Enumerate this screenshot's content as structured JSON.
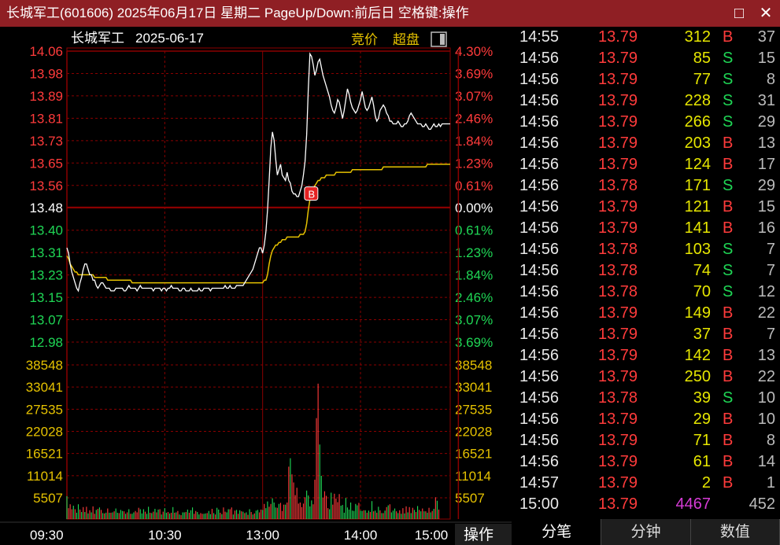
{
  "window": {
    "title": "长城军工(601606) 2025年06月17日 星期二 PageUp/Down:前后日 空格键:操作",
    "maximize_icon": "□",
    "close_icon": "✕"
  },
  "chart_header": {
    "stock_name": "长城军工",
    "date": "2025-06-17",
    "auction_label": "竞价",
    "super_label": "超盘"
  },
  "colors": {
    "up": "#ff3b3b",
    "down": "#1fd655",
    "avg": "#e6c200",
    "price": "#ffffff",
    "grid": "#8b0000",
    "title_bg": "#8f1f24"
  },
  "chart_data": [
    {
      "type": "line",
      "title": "",
      "prev_close": 13.48,
      "y_ticks_left": [
        "14.06",
        "13.98",
        "13.89",
        "13.81",
        "13.73",
        "13.65",
        "13.56",
        "13.48",
        "13.40",
        "13.31",
        "13.23",
        "13.15",
        "13.07",
        "12.98"
      ],
      "y_ticks_right": [
        "4.30%",
        "3.69%",
        "3.07%",
        "2.46%",
        "1.84%",
        "1.23%",
        "0.61%",
        "0.00%",
        "0.61%",
        "1.23%",
        "1.84%",
        "2.46%",
        "3.07%",
        "3.69%"
      ],
      "ylim": [
        12.98,
        14.06
      ],
      "x_ticks": [
        "09:30",
        "10:30",
        "13:00",
        "14:00",
        "15:00"
      ],
      "marker": {
        "label": "B",
        "time_index": 150,
        "price": 13.53
      },
      "series": [
        {
          "name": "",
          "values": [
            13.33,
            13.31,
            13.27,
            13.24,
            13.22,
            13.2,
            13.18,
            13.17,
            13.2,
            13.22,
            13.25,
            13.27,
            13.27,
            13.25,
            13.23,
            13.23,
            13.21,
            13.21,
            13.19,
            13.18,
            13.19,
            13.2,
            13.2,
            13.19,
            13.18,
            13.18,
            13.18,
            13.17,
            13.17,
            13.17,
            13.18,
            13.18,
            13.18,
            13.18,
            13.18,
            13.17,
            13.17,
            13.18,
            13.19,
            13.18,
            13.18,
            13.18,
            13.18,
            13.17,
            13.18,
            13.19,
            13.18,
            13.18,
            13.18,
            13.18,
            13.18,
            13.18,
            13.18,
            13.17,
            13.18,
            13.18,
            13.18,
            13.18,
            13.17,
            13.18,
            13.18,
            13.17,
            13.18,
            13.18,
            13.19,
            13.18,
            13.18,
            13.18,
            13.18,
            13.17,
            13.17,
            13.18,
            13.18,
            13.17,
            13.17,
            13.17,
            13.18,
            13.17,
            13.17,
            13.17,
            13.17,
            13.18,
            13.17,
            13.17,
            13.18,
            13.18,
            13.18,
            13.18,
            13.17,
            13.18,
            13.18,
            13.18,
            13.18,
            13.18,
            13.18,
            13.18,
            13.18,
            13.19,
            13.18,
            13.18,
            13.19,
            13.18,
            13.18,
            13.18,
            13.19,
            13.19,
            13.19,
            13.19,
            13.19,
            13.2,
            13.21,
            13.22,
            13.23,
            13.24,
            13.25,
            13.27,
            13.29,
            13.31,
            13.33,
            13.33,
            13.31,
            13.34,
            13.39,
            13.47,
            13.58,
            13.7,
            13.76,
            13.73,
            13.66,
            13.6,
            13.62,
            13.64,
            13.6,
            13.59,
            13.58,
            13.61,
            13.58,
            13.57,
            13.54,
            13.53,
            13.53,
            13.52,
            13.52,
            13.54,
            13.56,
            13.6,
            13.65,
            13.75,
            13.92,
            14.05,
            14.04,
            14.01,
            13.97,
            13.99,
            14.02,
            14.03,
            14.0,
            13.97,
            13.95,
            13.93,
            13.91,
            13.89,
            13.86,
            13.84,
            13.83,
            13.85,
            13.88,
            13.87,
            13.84,
            13.81,
            13.84,
            13.88,
            13.92,
            13.9,
            13.87,
            13.85,
            13.84,
            13.83,
            13.84,
            13.86,
            13.88,
            13.91,
            13.88,
            13.85,
            13.84,
            13.85,
            13.87,
            13.89,
            13.86,
            13.82,
            13.8,
            13.81,
            13.84,
            13.85,
            13.86,
            13.85,
            13.83,
            13.82,
            13.8,
            13.8,
            13.79,
            13.79,
            13.79,
            13.8,
            13.79,
            13.78,
            13.78,
            13.79,
            13.79,
            13.8,
            13.82,
            13.83,
            13.82,
            13.81,
            13.8,
            13.79,
            13.79,
            13.79,
            13.78,
            13.78,
            13.79,
            13.78,
            13.77,
            13.77,
            13.78,
            13.79,
            13.78,
            13.78,
            13.79,
            13.78,
            13.79,
            13.79,
            13.79,
            13.79,
            13.79,
            13.79
          ]
        },
        {
          "name": "",
          "values": [
            13.3,
            13.29,
            13.27,
            13.26,
            13.25,
            13.24,
            13.24,
            13.23,
            13.23,
            13.23,
            13.23,
            13.23,
            13.23,
            13.23,
            13.23,
            13.23,
            13.23,
            13.22,
            13.22,
            13.22,
            13.22,
            13.22,
            13.22,
            13.22,
            13.22,
            13.21,
            13.21,
            13.21,
            13.21,
            13.21,
            13.21,
            13.21,
            13.21,
            13.21,
            13.21,
            13.21,
            13.21,
            13.21,
            13.21,
            13.21,
            13.2,
            13.2,
            13.2,
            13.2,
            13.2,
            13.2,
            13.2,
            13.2,
            13.2,
            13.2,
            13.2,
            13.2,
            13.2,
            13.2,
            13.2,
            13.2,
            13.2,
            13.2,
            13.2,
            13.2,
            13.2,
            13.2,
            13.2,
            13.2,
            13.2,
            13.2,
            13.2,
            13.2,
            13.2,
            13.2,
            13.2,
            13.2,
            13.2,
            13.2,
            13.2,
            13.2,
            13.2,
            13.2,
            13.2,
            13.2,
            13.2,
            13.2,
            13.2,
            13.2,
            13.2,
            13.2,
            13.2,
            13.2,
            13.2,
            13.2,
            13.2,
            13.2,
            13.2,
            13.2,
            13.2,
            13.2,
            13.2,
            13.2,
            13.2,
            13.2,
            13.2,
            13.2,
            13.2,
            13.2,
            13.2,
            13.2,
            13.2,
            13.2,
            13.2,
            13.2,
            13.2,
            13.2,
            13.2,
            13.2,
            13.2,
            13.2,
            13.2,
            13.2,
            13.2,
            13.2,
            13.2,
            13.21,
            13.21,
            13.23,
            13.27,
            13.3,
            13.32,
            13.33,
            13.34,
            13.34,
            13.35,
            13.35,
            13.36,
            13.36,
            13.36,
            13.37,
            13.37,
            13.37,
            13.37,
            13.37,
            13.37,
            13.37,
            13.37,
            13.38,
            13.38,
            13.38,
            13.39,
            13.42,
            13.47,
            13.51,
            13.53,
            13.55,
            13.56,
            13.57,
            13.58,
            13.58,
            13.59,
            13.59,
            13.59,
            13.6,
            13.6,
            13.6,
            13.6,
            13.6,
            13.6,
            13.61,
            13.61,
            13.61,
            13.61,
            13.61,
            13.61,
            13.61,
            13.61,
            13.61,
            13.61,
            13.62,
            13.62,
            13.62,
            13.62,
            13.62,
            13.62,
            13.62,
            13.62,
            13.62,
            13.62,
            13.62,
            13.62,
            13.62,
            13.62,
            13.62,
            13.62,
            13.62,
            13.62,
            13.62,
            13.63,
            13.63,
            13.63,
            13.63,
            13.63,
            13.63,
            13.63,
            13.63,
            13.63,
            13.63,
            13.63,
            13.63,
            13.63,
            13.63,
            13.63,
            13.63,
            13.63,
            13.63,
            13.63,
            13.63,
            13.63,
            13.63,
            13.63,
            13.63,
            13.63,
            13.63,
            13.63,
            13.64,
            13.64,
            13.64,
            13.64,
            13.64,
            13.64,
            13.64,
            13.64,
            13.64,
            13.64,
            13.64,
            13.64,
            13.64,
            13.64,
            13.64
          ]
        }
      ]
    },
    {
      "type": "bar",
      "title": "",
      "y_ticks": [
        "38548",
        "33041",
        "27535",
        "22028",
        "16521",
        "11014",
        "5507"
      ],
      "ylim": [
        0,
        44055
      ],
      "values": [
        6500,
        3100,
        4200,
        2800,
        3800,
        2800,
        1800,
        4200,
        2700,
        2000,
        3400,
        2000,
        3500,
        1600,
        2500,
        1900,
        3600,
        1500,
        2600,
        2900,
        3300,
        2600,
        1700,
        1600,
        1800,
        3000,
        1800,
        1800,
        1900,
        2200,
        3000,
        1800,
        1700,
        2600,
        2300,
        2200,
        1500,
        1900,
        2800,
        1500,
        1500,
        1900,
        2300,
        1900,
        3200,
        2800,
        1600,
        2800,
        2100,
        1500,
        3500,
        1800,
        1700,
        2100,
        2900,
        1900,
        2700,
        2800,
        1300,
        2100,
        3100,
        1800,
        2000,
        1600,
        1800,
        3400,
        1800,
        1900,
        2300,
        1300,
        1100,
        1900,
        1900,
        2000,
        2700,
        1800,
        2500,
        3300,
        1500,
        2300,
        2000,
        1300,
        1700,
        1500,
        1500,
        1600,
        1700,
        2300,
        1400,
        2900,
        1700,
        1300,
        3200,
        2700,
        1800,
        1400,
        3300,
        2100,
        1900,
        2800,
        2800,
        3300,
        1300,
        2400,
        2600,
        1500,
        2500,
        2200,
        2100,
        1700,
        1900,
        1200,
        2800,
        2000,
        1300,
        1600,
        2400,
        2600,
        1900,
        2700,
        2600,
        4300,
        3100,
        5000,
        3500,
        4300,
        5900,
        4700,
        3300,
        3200,
        4300,
        4600,
        2300,
        4100,
        4100,
        4700,
        14900,
        17300,
        12700,
        10400,
        6800,
        8900,
        4400,
        4700,
        3400,
        4400,
        6200,
        8100,
        6700,
        3600,
        5300,
        4200,
        11200,
        28700,
        38500,
        21200,
        12300,
        6000,
        7900,
        6600,
        3100,
        2800,
        7500,
        4100,
        7200,
        5800,
        4800,
        7100,
        3800,
        4000,
        1800,
        6000,
        3300,
        2700,
        4700,
        2400,
        2300,
        4300,
        3900,
        4600,
        2400,
        2300,
        2500,
        2500,
        1800,
        2400,
        2000,
        5100,
        2200,
        2400,
        1800,
        3500,
        2500,
        1700,
        1700,
        2400,
        3400,
        3900,
        4200,
        1900,
        2400,
        3000,
        2200,
        1700,
        2500,
        1500,
        3100,
        1600,
        3600,
        1900,
        3400,
        1700,
        3200,
        2600,
        2000,
        3700,
        2600,
        2200,
        3000,
        2200,
        2200,
        1800,
        3200,
        1900,
        2300,
        2900,
        6200,
        5200,
        2700
      ],
      "directions": "SBBBSBSSBSBSBSBSBBSBSBSBSBSBSBSSBSSBSBSBSSBBBSSSBSSBSBSBSBSBSSBSBSBSBSBSSBSBSSBBSSBBSSBSSBSBSSBSBBSSBBSBSBSBSBSBSBSBSSBBSBSSBBSSSBSBBBSBBSBBBBBBBBBSSSSBBBBSSBBBBSSBBBBBSSSSSSSSSSSBSSBSBSBSBSBSBSBSBSBSSSBSBSBSBSBSBSBSBSBSBSBSBSBSBSBSSBSBSBBS"
    }
  ],
  "panel_label": "操作",
  "trades": [
    {
      "time": "14:55",
      "price": "13.79",
      "vol": "312",
      "side": "B",
      "count": "37"
    },
    {
      "time": "14:56",
      "price": "13.79",
      "vol": "85",
      "side": "S",
      "count": "15"
    },
    {
      "time": "14:56",
      "price": "13.79",
      "vol": "77",
      "side": "S",
      "count": "8"
    },
    {
      "time": "14:56",
      "price": "13.79",
      "vol": "228",
      "side": "S",
      "count": "31"
    },
    {
      "time": "14:56",
      "price": "13.79",
      "vol": "266",
      "side": "S",
      "count": "29"
    },
    {
      "time": "14:56",
      "price": "13.79",
      "vol": "203",
      "side": "B",
      "count": "13"
    },
    {
      "time": "14:56",
      "price": "13.79",
      "vol": "124",
      "side": "B",
      "count": "17"
    },
    {
      "time": "14:56",
      "price": "13.78",
      "vol": "171",
      "side": "S",
      "count": "29"
    },
    {
      "time": "14:56",
      "price": "13.79",
      "vol": "121",
      "side": "B",
      "count": "15"
    },
    {
      "time": "14:56",
      "price": "13.79",
      "vol": "141",
      "side": "B",
      "count": "16"
    },
    {
      "time": "14:56",
      "price": "13.78",
      "vol": "103",
      "side": "S",
      "count": "7"
    },
    {
      "time": "14:56",
      "price": "13.78",
      "vol": "74",
      "side": "S",
      "count": "7"
    },
    {
      "time": "14:56",
      "price": "13.78",
      "vol": "70",
      "side": "S",
      "count": "12"
    },
    {
      "time": "14:56",
      "price": "13.79",
      "vol": "149",
      "side": "B",
      "count": "22"
    },
    {
      "time": "14:56",
      "price": "13.79",
      "vol": "37",
      "side": "B",
      "count": "7"
    },
    {
      "time": "14:56",
      "price": "13.79",
      "vol": "142",
      "side": "B",
      "count": "13"
    },
    {
      "time": "14:56",
      "price": "13.79",
      "vol": "250",
      "side": "B",
      "count": "22"
    },
    {
      "time": "14:56",
      "price": "13.78",
      "vol": "39",
      "side": "S",
      "count": "10"
    },
    {
      "time": "14:56",
      "price": "13.79",
      "vol": "29",
      "side": "B",
      "count": "10"
    },
    {
      "time": "14:56",
      "price": "13.79",
      "vol": "71",
      "side": "B",
      "count": "8"
    },
    {
      "time": "14:56",
      "price": "13.79",
      "vol": "61",
      "side": "B",
      "count": "14"
    },
    {
      "time": "14:57",
      "price": "13.79",
      "vol": "2",
      "side": "B",
      "count": "1"
    },
    {
      "time": "15:00",
      "price": "13.79",
      "vol": "4467",
      "side": "",
      "count": "452"
    }
  ],
  "tabs": [
    "分笔",
    "分钟",
    "数值"
  ]
}
